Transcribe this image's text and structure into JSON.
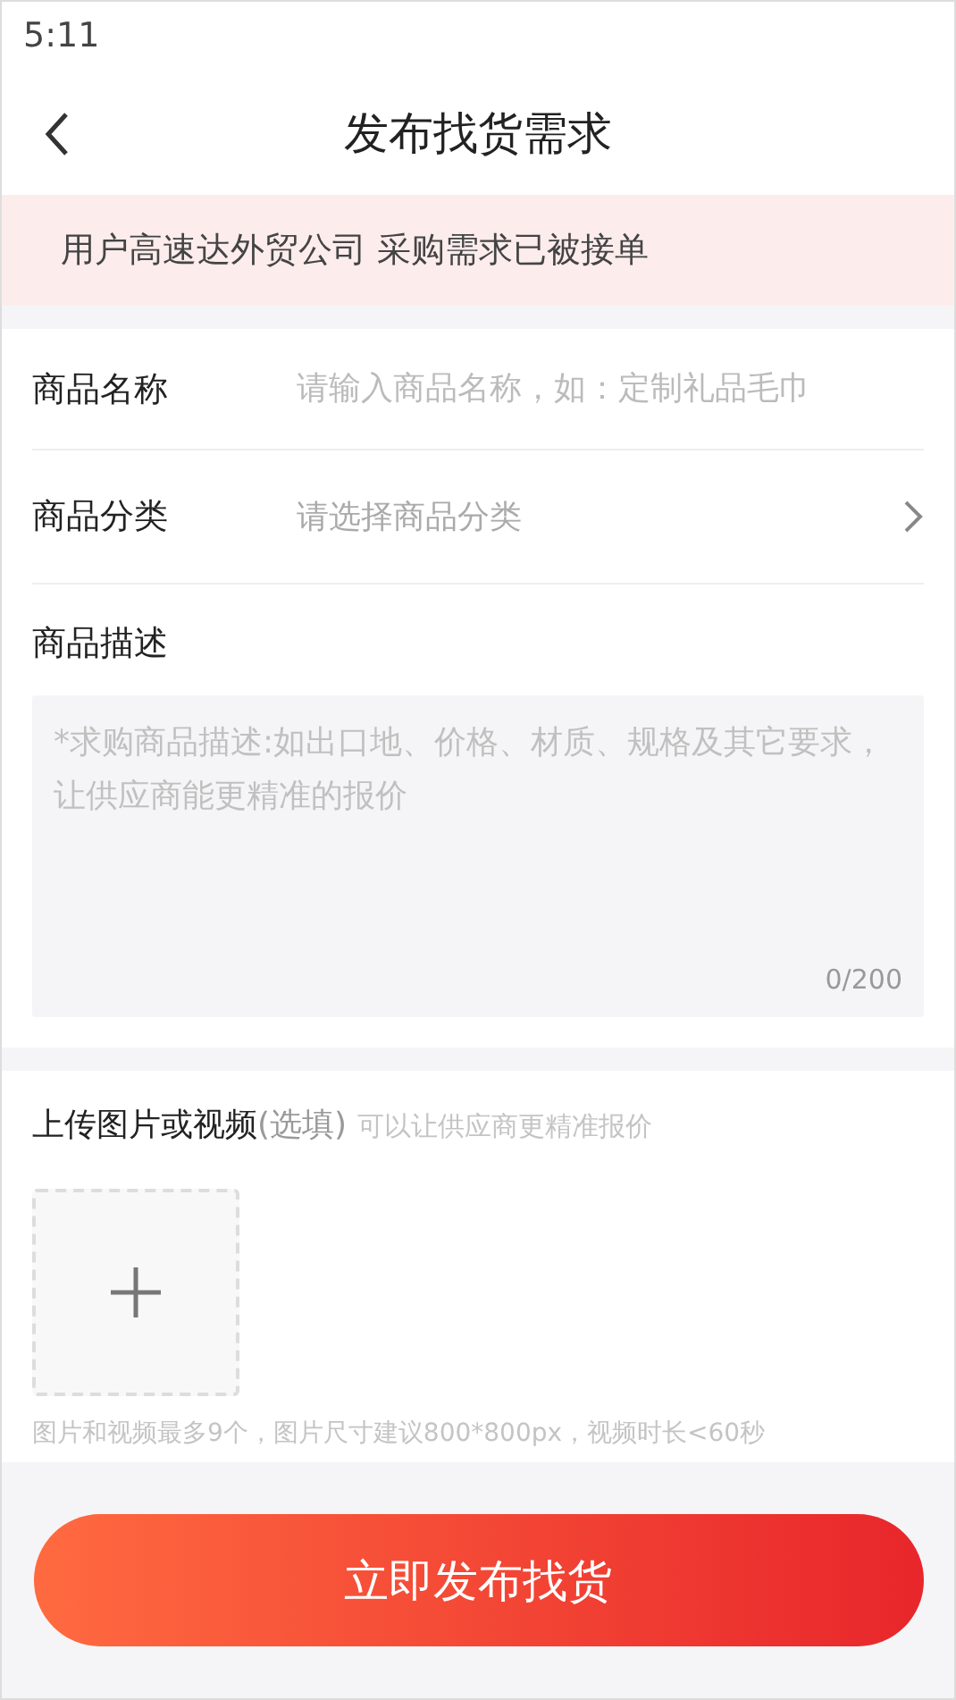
{
  "status_bar": {
    "time": "5:11"
  },
  "nav": {
    "title": "发布找货需求"
  },
  "notice": "用户高速达外贸公司 采购需求已被接单",
  "fields": [
    {
      "kind": "input",
      "label": "商品名称",
      "placeholder": "请输入商品名称，如：定制礼品毛巾"
    },
    {
      "kind": "select",
      "label": "商品分类",
      "placeholder": "请选择商品分类"
    }
  ],
  "description": {
    "label": "商品描述",
    "placeholder": "*求购商品描述:如出口地、价格、材质、规格及其它要求，让供应商能更精准的报价",
    "counter": "0/200"
  },
  "upload": {
    "title": "上传图片或视频",
    "optional": "(选填)",
    "hint": "可以让供应商更精准报价",
    "note": "图片和视频最多9个，图片尺寸建议800*800px，视频时长<60秒"
  },
  "submit": "立即发布找货"
}
